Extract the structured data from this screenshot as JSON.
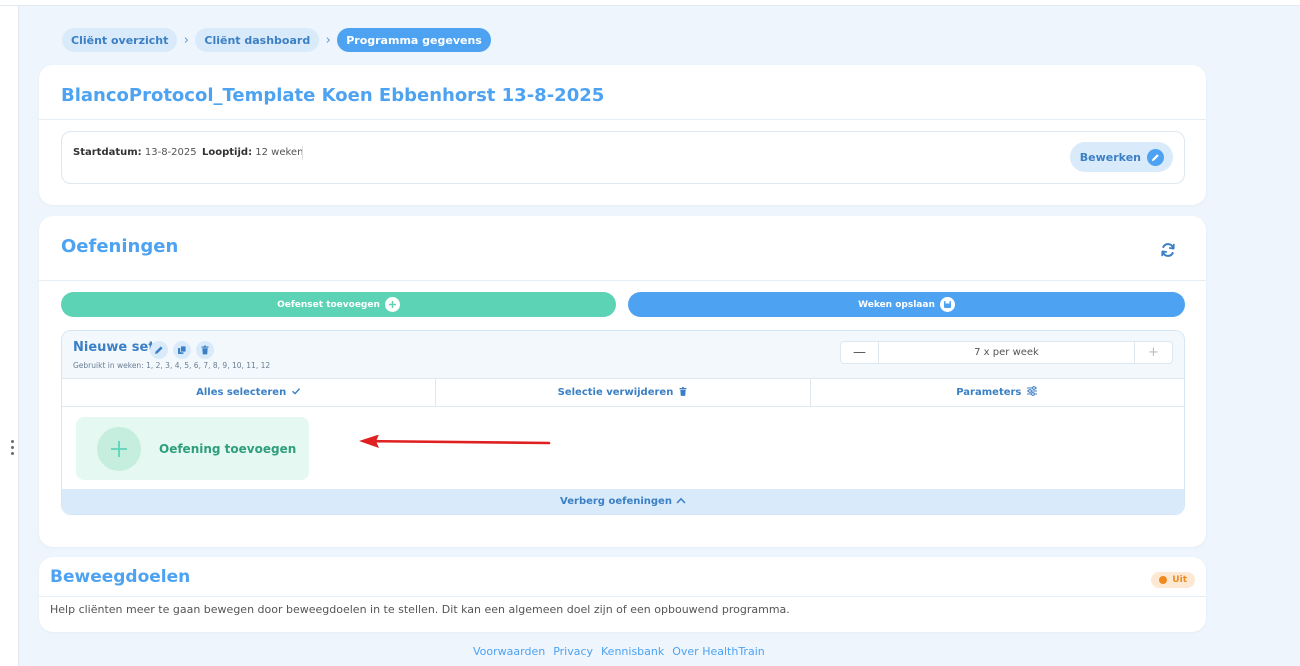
{
  "breadcrumb": [
    {
      "label": "Cliënt overzicht"
    },
    {
      "label": "Cliënt dashboard"
    },
    {
      "label": "Programma gegevens"
    }
  ],
  "program": {
    "title": "BlancoProtocol_Template Koen Ebbenhorst 13-8-2025",
    "start_label": "Startdatum:",
    "start_value": "13-8-2025",
    "duration_label": "Looptijd:",
    "duration_value": "12 weken",
    "edit_label": "Bewerken"
  },
  "exercises": {
    "title": "Oefeningen",
    "add_set_label": "Oefenset toevoegen",
    "save_weeks_label": "Weken opslaan",
    "set": {
      "name": "Nieuwe set",
      "weeks_text": "Gebruikt in weken: 1, 2, 3, 4, 5, 6, 7, 8, 9, 10, 11, 12",
      "frequency": "7 x per week",
      "select_all_label": "Alles selecteren",
      "remove_selection_label": "Selectie verwijderen",
      "parameters_label": "Parameters",
      "add_exercise_label": "Oefening toevoegen",
      "hide_label": "Verberg oefeningen"
    }
  },
  "goals": {
    "title": "Beweegdoelen",
    "badge": "Uit",
    "description": "Help cliënten meer te gaan bewegen door beweegdoelen in te stellen. Dit kan een algemeen doel zijn of een opbouwend programma."
  },
  "footer": [
    "Voorwaarden",
    "Privacy",
    "Kennisbank",
    "Over HealthTrain"
  ],
  "colors": {
    "accent": "#4da3f2",
    "green": "#5dd3b6",
    "arrow": "#e02020",
    "badge": "#f18a1e"
  }
}
